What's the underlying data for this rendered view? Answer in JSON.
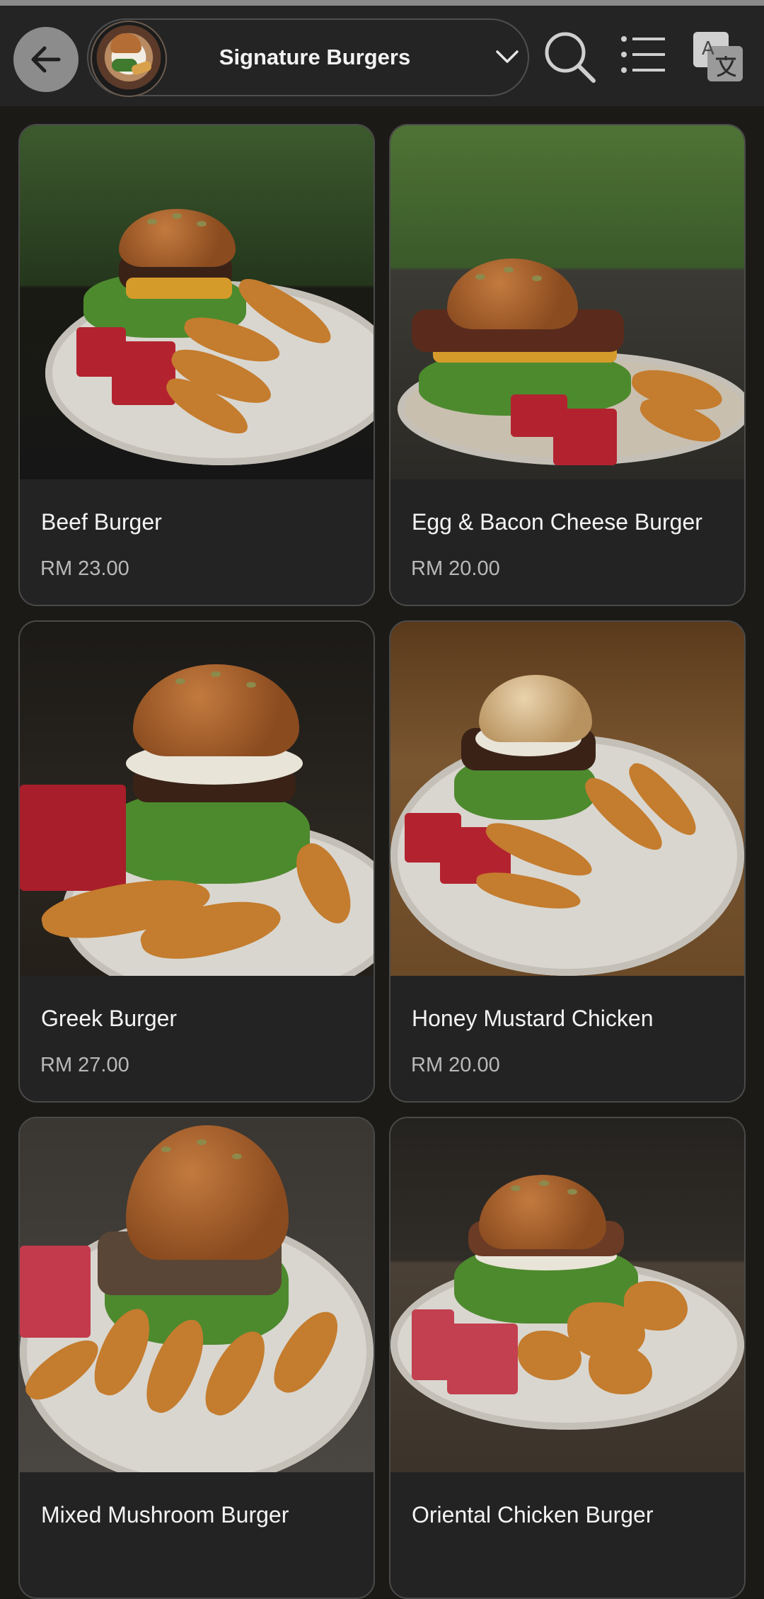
{
  "header": {
    "category": "Signature Burgers",
    "icons": [
      "back-arrow-icon",
      "burger-thumbnail",
      "chevron-down-icon",
      "search-icon",
      "list-icon",
      "translate-icon"
    ]
  },
  "items": [
    {
      "name": "Beef Burger",
      "price": "RM 23.00"
    },
    {
      "name": "Egg & Bacon Cheese Burger",
      "price": "RM 20.00"
    },
    {
      "name": "Greek Burger",
      "price": "RM 27.00"
    },
    {
      "name": "Honey Mustard Chicken",
      "price": "RM 20.00"
    },
    {
      "name": "Mixed Mushroom Burger",
      "price": ""
    },
    {
      "name": "Oriental Chicken Burger",
      "price": ""
    }
  ],
  "colors": {
    "background": "#1b1a17",
    "header": "#242424",
    "card": "#232323",
    "price_text": "#b9b9b9"
  }
}
